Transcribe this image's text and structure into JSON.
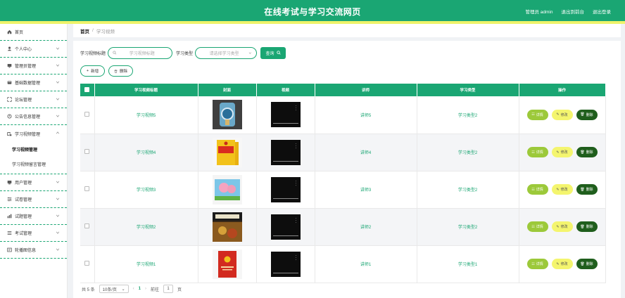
{
  "header": {
    "title": "在线考试与学习交流网页",
    "admin_label": "管理员 admin",
    "back_frontend": "退出到前台",
    "logout": "退出登录"
  },
  "colors": {
    "primary": "#1aa673",
    "accent_stripe": "#eef36a",
    "detail": "#9cc93a",
    "edit": "#f4f56e",
    "delete": "#1f5e1c"
  },
  "sidebar": {
    "items": [
      {
        "label": "首页",
        "icon": "home-icon"
      },
      {
        "label": "个人中心",
        "icon": "user-icon"
      },
      {
        "label": "管理员管理",
        "icon": "monitor-icon"
      },
      {
        "label": "基础数据管理",
        "icon": "database-icon"
      },
      {
        "label": "论坛管理",
        "icon": "forum-icon"
      },
      {
        "label": "公告信息管理",
        "icon": "notice-icon"
      },
      {
        "label": "学习视频管理",
        "icon": "video-icon",
        "expanded": true,
        "children": [
          "学习视频管理",
          "学习视频留言管理"
        ]
      },
      {
        "label": "用户管理",
        "icon": "users-icon"
      },
      {
        "label": "试卷管理",
        "icon": "paper-icon"
      },
      {
        "label": "试题管理",
        "icon": "question-icon"
      },
      {
        "label": "考试管理",
        "icon": "exam-icon"
      },
      {
        "label": "轮播图信息",
        "icon": "carousel-icon"
      }
    ]
  },
  "breadcrumb": {
    "home": "首页",
    "sep": "/",
    "current": "学习视频"
  },
  "search": {
    "title_label": "学习视频标题",
    "title_placeholder": "学习视频标题",
    "type_label": "学习类型",
    "type_placeholder": "请选择学习类型",
    "query_button": "查询"
  },
  "actions": {
    "add": "新增",
    "delete": "删除"
  },
  "table": {
    "columns": [
      "学习视频标题",
      "封面",
      "视频",
      "讲师",
      "学习类型",
      "操作"
    ],
    "rows": [
      {
        "title": "学习视频5",
        "teacher": "讲师5",
        "type": "学习类型2",
        "cover": "cover-5"
      },
      {
        "title": "学习视频4",
        "teacher": "讲师4",
        "type": "学习类型2",
        "cover": "cover-4"
      },
      {
        "title": "学习视频3",
        "teacher": "讲师3",
        "type": "学习类型2",
        "cover": "cover-3"
      },
      {
        "title": "学习视频2",
        "teacher": "讲师2",
        "type": "学习类型2",
        "cover": "cover-2"
      },
      {
        "title": "学习视频1",
        "teacher": "讲师1",
        "type": "学习类型1",
        "cover": "cover-1"
      }
    ],
    "op_labels": {
      "detail": "详情",
      "edit": "修改",
      "delete": "删除"
    }
  },
  "pagination": {
    "total": "共 5 条",
    "page_size": "10条/页",
    "current_page": "1",
    "goto_label": "前往",
    "goto_value": "1",
    "page_suffix": "页"
  }
}
